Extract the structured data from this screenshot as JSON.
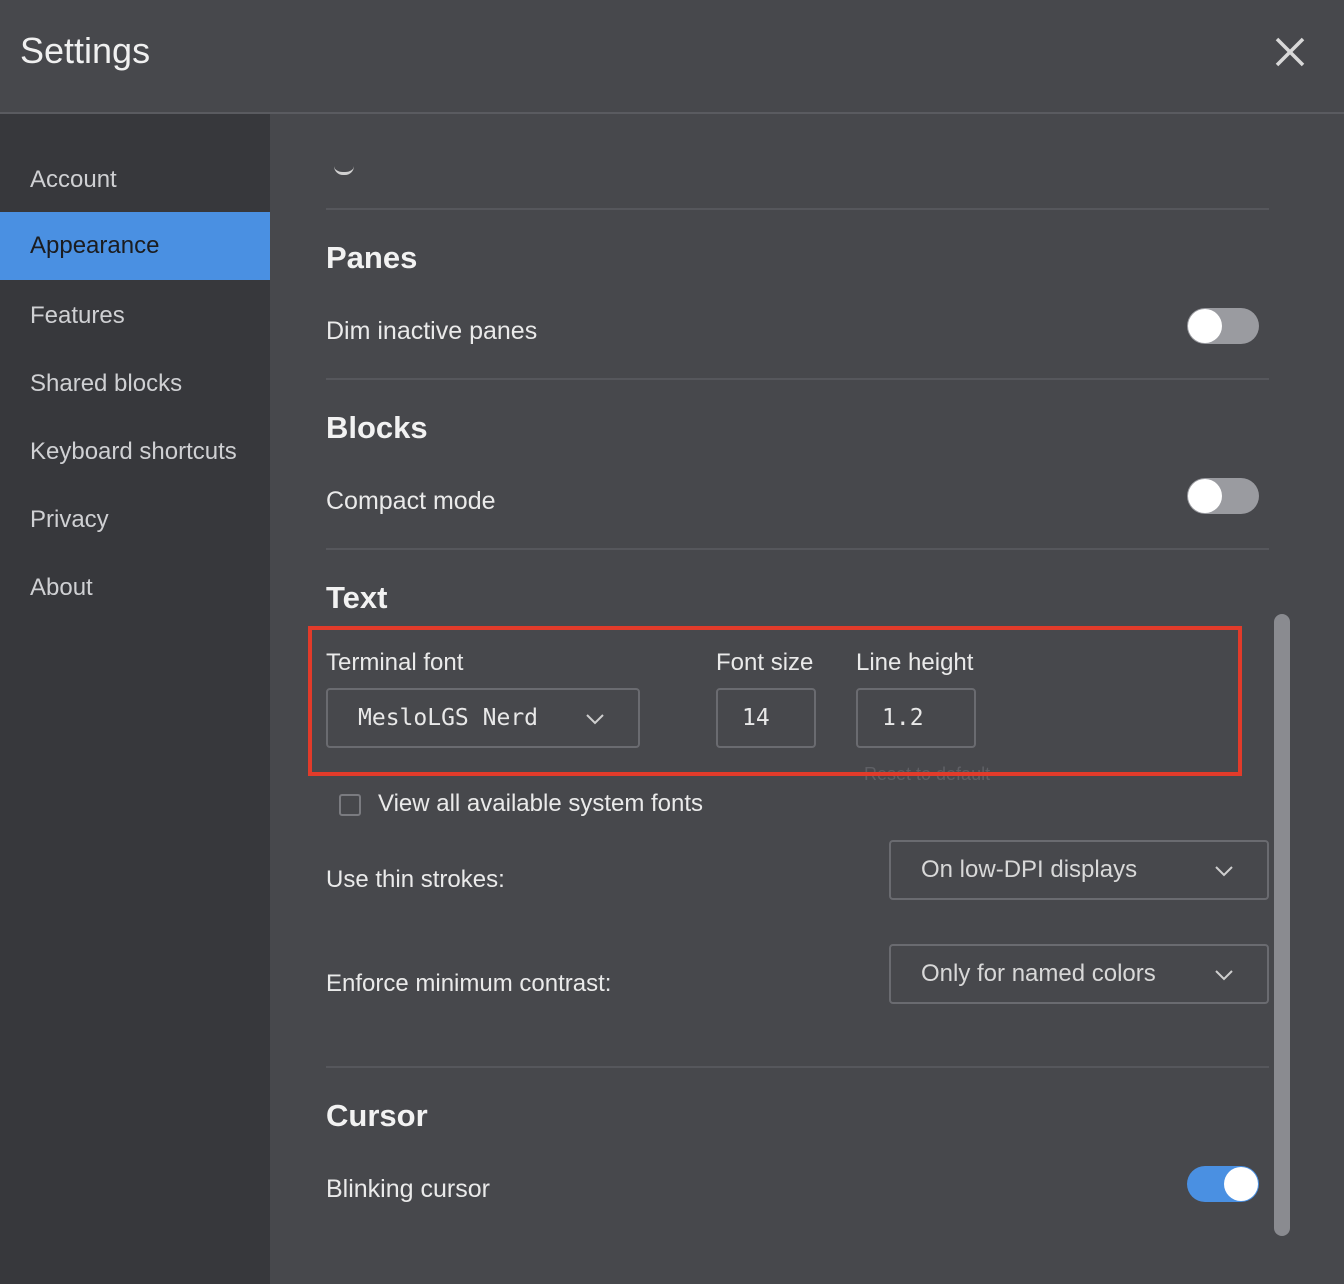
{
  "window": {
    "title": "Settings"
  },
  "sidebar": {
    "items": [
      {
        "label": "Account",
        "active": false
      },
      {
        "label": "Appearance",
        "active": true
      },
      {
        "label": "Features",
        "active": false
      },
      {
        "label": "Shared blocks",
        "active": false
      },
      {
        "label": "Keyboard shortcuts",
        "active": false
      },
      {
        "label": "Privacy",
        "active": false
      },
      {
        "label": "About",
        "active": false
      }
    ]
  },
  "panes": {
    "title": "Panes",
    "dim_inactive": {
      "label": "Dim inactive panes",
      "enabled": false
    }
  },
  "blocks": {
    "title": "Blocks",
    "compact_mode": {
      "label": "Compact mode",
      "enabled": false
    }
  },
  "text": {
    "title": "Text",
    "terminal_font": {
      "label": "Terminal font",
      "value": "MesloLGS Nerd"
    },
    "font_size": {
      "label": "Font size",
      "value": "14"
    },
    "line_height": {
      "label": "Line height",
      "value": "1.2"
    },
    "reset_label": "Reset to default",
    "view_all_fonts": {
      "label": "View all available system fonts",
      "checked": false
    },
    "thin_strokes": {
      "label": "Use thin strokes:",
      "value": "On low-DPI displays"
    },
    "min_contrast": {
      "label": "Enforce minimum contrast:",
      "value": "Only for named colors"
    }
  },
  "cursor": {
    "title": "Cursor",
    "blinking": {
      "label": "Blinking cursor",
      "enabled": true
    }
  },
  "colors": {
    "accent": "#4a90e2",
    "highlight": "#e23b2a",
    "background": "#47484c",
    "sidebar": "#37383c"
  },
  "icons": {
    "close": "close-icon",
    "dropdown": "chevron-down-icon"
  }
}
